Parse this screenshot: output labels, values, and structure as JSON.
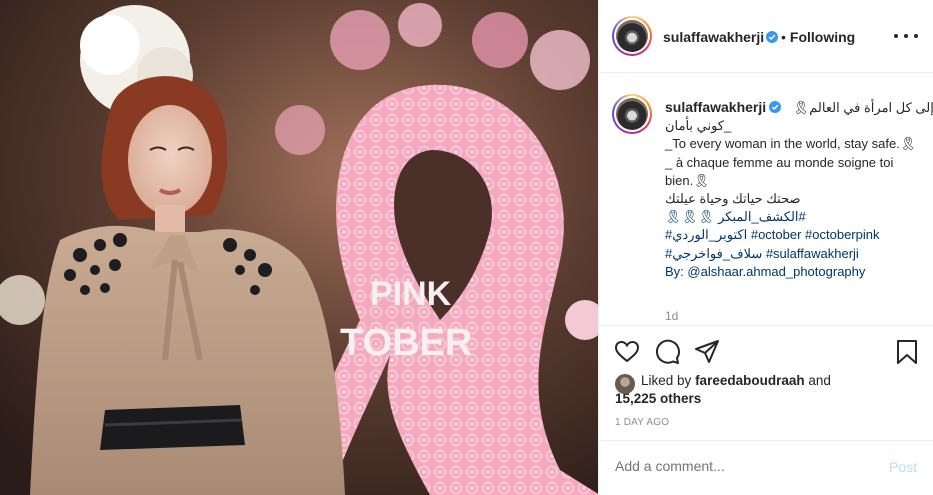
{
  "photo": {
    "alt_content": "photo",
    "ribbon_text_line1": "PINK",
    "ribbon_text_line2": "TOBER"
  },
  "header": {
    "username": "sulaffawakherji",
    "verified": true,
    "separator": "•",
    "follow_label": "Following",
    "more_icon": "ellipsis-icon"
  },
  "caption": {
    "username": "sulaffawakherji",
    "lines": [
      "إلى كل امرأة في العالم🎗",
      "_كوني بأمان",
      "_To every woman in the world, stay safe.🎗",
      "_ à chaque femme au monde soigne toi bien.🎗",
      "صحتك حياتك وحياة عيلتك",
      "#الكشف_المبكر 🎗🎗🎗",
      "#اكتوبر_الوردي #october #octoberpink",
      "#سلاف_فواخرجي #sulaffawakherji",
      "By: @alshaar.ahmad_photography"
    ],
    "time_ago": "1d"
  },
  "actions": {
    "like_icon": "heart-icon",
    "comment_icon": "comment-icon",
    "share_icon": "paper-plane-icon",
    "save_icon": "bookmark-icon"
  },
  "likes": {
    "prefix": "Liked by",
    "user": "fareedaboudraah",
    "connector": "and",
    "others": "15,225 others"
  },
  "post_date": "1 DAY AGO",
  "comment": {
    "placeholder": "Add a comment...",
    "post_label": "Post"
  },
  "colors": {
    "link": "#00376b",
    "post_button": "#b2dffc",
    "muted": "#8e8e8e",
    "text": "#262626",
    "verified_blue": "#3897f0",
    "ribbon_pink": "#f4b6c9"
  }
}
